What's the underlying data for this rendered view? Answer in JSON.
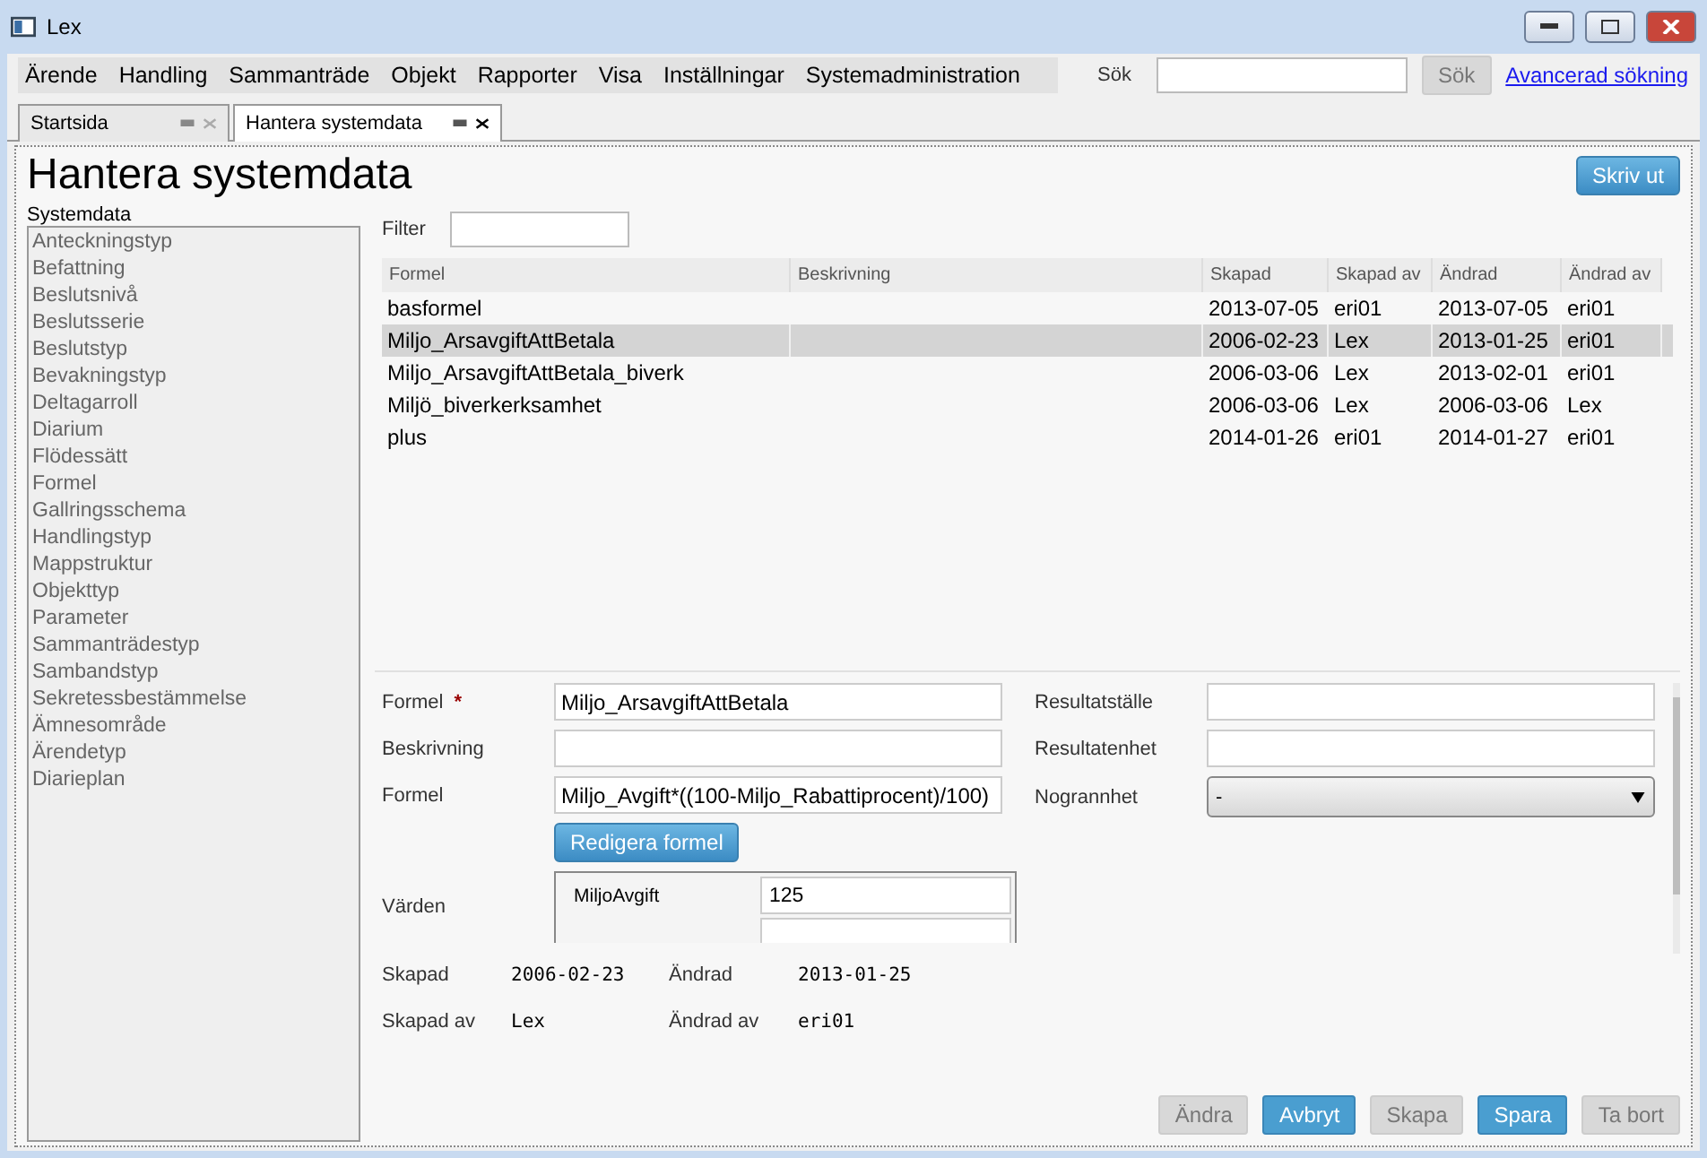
{
  "window": {
    "title": "Lex"
  },
  "menu": [
    "Ärende",
    "Handling",
    "Sammanträde",
    "Objekt",
    "Rapporter",
    "Visa",
    "Inställningar",
    "Systemadministration"
  ],
  "search": {
    "label": "Sök",
    "button": "Sök",
    "button_disabled": true,
    "link": "Avancerad sökning"
  },
  "tabs": [
    {
      "label": "Startsida",
      "selected": false
    },
    {
      "label": "Hantera systemdata",
      "selected": true
    }
  ],
  "page_title": "Hantera systemdata",
  "print_button": "Skriv ut",
  "sidebar": {
    "title": "Systemdata",
    "items": [
      "Anteckningstyp",
      "Befattning",
      "Beslutsnivå",
      "Beslutsserie",
      "Beslutstyp",
      "Bevakningstyp",
      "Deltagarroll",
      "Diarium",
      "Flödessätt",
      "Formel",
      "Gallringsschema",
      "Handlingstyp",
      "Mappstruktur",
      "Objekttyp",
      "Parameter",
      "Sammanträdestyp",
      "Sambandstyp",
      "Sekretessbestämmelse",
      "Ämnesområde",
      "Ärendetyp",
      "Diarieplan"
    ]
  },
  "filter": {
    "label": "Filter"
  },
  "table": {
    "columns": [
      "Formel",
      "Beskrivning",
      "Skapad",
      "Skapad av",
      "Ändrad",
      "Ändrad av"
    ],
    "rows": [
      {
        "cells": [
          "basformel",
          "",
          "2013-07-05",
          "eri01",
          "2013-07-05",
          "eri01"
        ],
        "selected": false
      },
      {
        "cells": [
          "Miljo_ArsavgiftAttBetala",
          "",
          "2006-02-23",
          "Lex",
          "2013-01-25",
          "eri01"
        ],
        "selected": true
      },
      {
        "cells": [
          "Miljo_ArsavgiftAttBetala_biverk",
          "",
          "2006-03-06",
          "Lex",
          "2013-02-01",
          "eri01"
        ],
        "selected": false
      },
      {
        "cells": [
          "Miljö_biverkerksamhet",
          "",
          "2006-03-06",
          "Lex",
          "2006-03-06",
          "Lex"
        ],
        "selected": false
      },
      {
        "cells": [
          "plus",
          "",
          "2014-01-26",
          "eri01",
          "2014-01-27",
          "eri01"
        ],
        "selected": false
      }
    ]
  },
  "form": {
    "name_label": "Formel",
    "required_mark": "*",
    "name_value": "Miljo_ArsavgiftAttBetala",
    "description_label": "Beskrivning",
    "formula_label": "Formel",
    "formula_value": "Miljo_Avgift*((100-Miljo_Rabattiprocent)/100)",
    "edit_button": "Redigera formel",
    "values_label": "Värden",
    "values": [
      {
        "name": "MiljoAvgift",
        "value": "125"
      }
    ],
    "result_place_label": "Resultatställe",
    "result_unit_label": "Resultatenhet",
    "precision_label": "Nogrannhet",
    "precision_value": "-"
  },
  "meta": [
    {
      "label": "Skapad",
      "value": "2006-02-23"
    },
    {
      "label": "Ändrad",
      "value": "2013-01-25"
    },
    {
      "label": "Skapad av",
      "value": "Lex"
    },
    {
      "label": "Ändrad av",
      "value": "eri01"
    }
  ],
  "actions": [
    {
      "label": "Ändra",
      "disabled": true
    },
    {
      "label": "Avbryt",
      "disabled": false
    },
    {
      "label": "Skapa",
      "disabled": true
    },
    {
      "label": "Spara",
      "disabled": false
    },
    {
      "label": "Ta bort",
      "disabled": true
    }
  ]
}
